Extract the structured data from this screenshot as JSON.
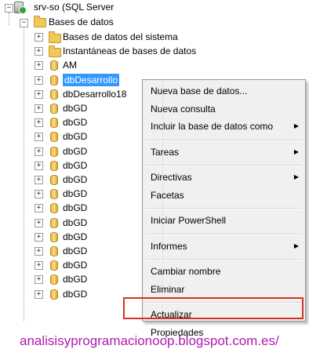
{
  "tree": {
    "server": "srv-so (SQL Server",
    "folder": "Bases de datos",
    "items": [
      {
        "label": "Bases de datos del sistema",
        "icon": "folder"
      },
      {
        "label": "Instantáneas de bases de datos",
        "icon": "folder"
      },
      {
        "label": "AM",
        "icon": "database"
      },
      {
        "label": "dbDesarrollo",
        "icon": "database",
        "selected": true
      },
      {
        "label": "dbDesarrollo18",
        "icon": "database"
      },
      {
        "label": "dbGD",
        "icon": "database"
      },
      {
        "label": "dbGD",
        "icon": "database"
      },
      {
        "label": "dbGD",
        "icon": "database"
      },
      {
        "label": "dbGD",
        "icon": "database"
      },
      {
        "label": "dbGD",
        "icon": "database"
      },
      {
        "label": "dbGD",
        "icon": "database"
      },
      {
        "label": "dbGD",
        "icon": "database"
      },
      {
        "label": "dbGD",
        "icon": "database"
      },
      {
        "label": "dbGD",
        "icon": "database"
      },
      {
        "label": "dbGD",
        "icon": "database"
      },
      {
        "label": "dbGD",
        "icon": "database"
      },
      {
        "label": "dbGD",
        "icon": "database"
      },
      {
        "label": "dbGD",
        "icon": "database"
      },
      {
        "label": "dbGD",
        "icon": "database"
      }
    ]
  },
  "context_menu": {
    "items": [
      {
        "label": "Nueva base de datos...",
        "submenu": false
      },
      {
        "label": "Nueva consulta",
        "submenu": false
      },
      {
        "label": "Incluir la base de datos como",
        "submenu": true
      },
      {
        "separator": true
      },
      {
        "label": "Tareas",
        "submenu": true
      },
      {
        "separator": true
      },
      {
        "label": "Directivas",
        "submenu": true
      },
      {
        "label": "Facetas",
        "submenu": false
      },
      {
        "separator": true
      },
      {
        "label": "Iniciar PowerShell",
        "submenu": false
      },
      {
        "separator": true
      },
      {
        "label": "Informes",
        "submenu": true
      },
      {
        "separator": true
      },
      {
        "label": "Cambiar nombre",
        "submenu": false
      },
      {
        "label": "Eliminar",
        "submenu": false
      },
      {
        "separator": true
      },
      {
        "label": "Actualizar",
        "submenu": false
      },
      {
        "label": "Propiedades",
        "submenu": false,
        "highlighted": true
      }
    ]
  },
  "watermark": "analisisyprogramacionoop.blogspot.com.es/",
  "colors": {
    "selection": "#3399ff",
    "highlight_border": "#d93025",
    "watermark": "#b01cb0"
  }
}
